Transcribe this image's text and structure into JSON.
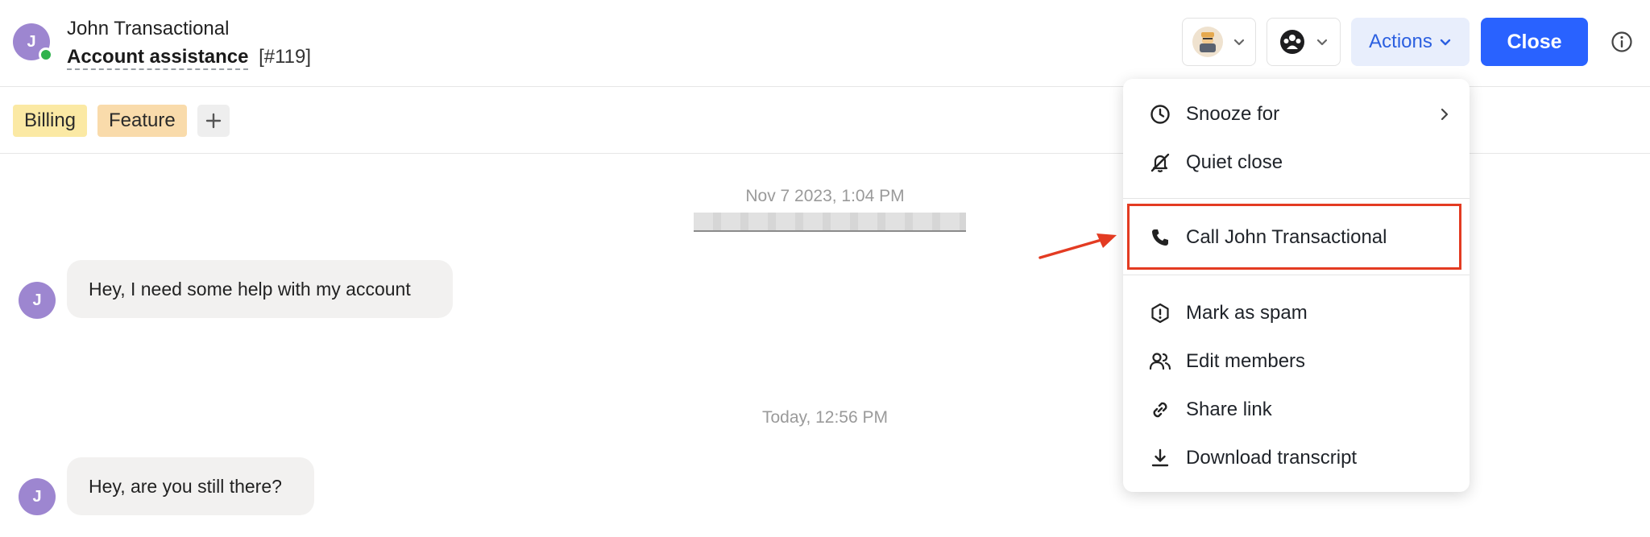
{
  "header": {
    "contact_initial": "J",
    "contact_name": "John Transactional",
    "conversation_title": "Account assistance",
    "conversation_number": "[#119]",
    "actions_label": "Actions",
    "close_label": "Close"
  },
  "tags": {
    "items": [
      {
        "label": "Billing",
        "color": "#fbe9a4"
      },
      {
        "label": "Feature",
        "color": "#f9dbab"
      }
    ]
  },
  "messages": [
    {
      "timestamp": "Nov 7 2023, 1:04 PM",
      "author_initial": "J",
      "text": "Hey, I need some help with my account"
    },
    {
      "timestamp": "Today, 12:56 PM",
      "author_initial": "J",
      "text": "Hey, are you still there?"
    }
  ],
  "actions_menu": {
    "items": [
      {
        "label": "Snooze for",
        "icon": "clock-icon"
      },
      {
        "label": "Quiet close",
        "icon": "bell-slash-icon"
      },
      {
        "label": "Call John Transactional",
        "icon": "phone-icon"
      },
      {
        "label": "Mark as spam",
        "icon": "spam-shield-icon"
      },
      {
        "label": "Edit members",
        "icon": "members-icon"
      },
      {
        "label": "Share link",
        "icon": "link-icon"
      },
      {
        "label": "Download transcript",
        "icon": "download-icon"
      }
    ]
  },
  "colors": {
    "accent": "#2962ff",
    "actions_bg": "#e8eefc",
    "avatar": "#9d86d0",
    "online": "#2fb24c",
    "highlight": "#e33b22"
  }
}
